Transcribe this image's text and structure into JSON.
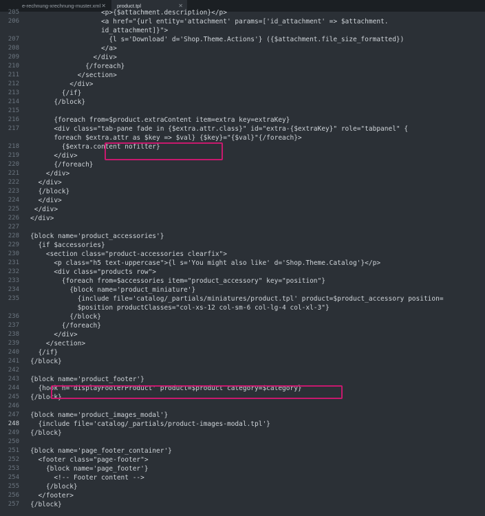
{
  "tabs": [
    {
      "label": "e-rechnung-xrechnung-muster.xml",
      "active": false
    },
    {
      "label": "product.tpl",
      "active": true
    }
  ],
  "lines": [
    {
      "n": "",
      "t": "                  <p>{$attachment.description}</p>"
    },
    {
      "n": "205",
      "t": "                  <p>{$attachment.description}</p>"
    },
    {
      "n": "206",
      "t": "                  <a href=\"{url entity='attachment' params=['id_attachment' => $attachment."
    },
    {
      "n": "",
      "t": "                  id_attachment]}\">"
    },
    {
      "n": "207",
      "t": "                    {l s='Download' d='Shop.Theme.Actions'} ({$attachment.file_size_formatted})"
    },
    {
      "n": "208",
      "t": "                  </a>"
    },
    {
      "n": "209",
      "t": "                </div>"
    },
    {
      "n": "210",
      "t": "              {/foreach}"
    },
    {
      "n": "211",
      "t": "            </section>"
    },
    {
      "n": "212",
      "t": "          </div>"
    },
    {
      "n": "213",
      "t": "        {/if}"
    },
    {
      "n": "214",
      "t": "      {/block}"
    },
    {
      "n": "215",
      "t": ""
    },
    {
      "n": "216",
      "t": "      {foreach from=$product.extraContent item=extra key=extraKey}"
    },
    {
      "n": "217",
      "t": "      <div class=\"tab-pane fade in {$extra.attr.class}\" id=\"extra-{$extraKey}\" role=\"tabpanel\" {"
    },
    {
      "n": "",
      "t": "      foreach $extra.attr as $key => $val} {$key}=\"{$val}\"{/foreach}>"
    },
    {
      "n": "218",
      "t": "        {$extra.content nofilter}"
    },
    {
      "n": "219",
      "t": "      </div>"
    },
    {
      "n": "220",
      "t": "      {/foreach}"
    },
    {
      "n": "221",
      "t": "    </div>"
    },
    {
      "n": "222",
      "t": "  </div>"
    },
    {
      "n": "223",
      "t": "  {/block}"
    },
    {
      "n": "224",
      "t": "  </div>"
    },
    {
      "n": "225",
      "t": " </div>"
    },
    {
      "n": "226",
      "t": "</div>"
    },
    {
      "n": "227",
      "t": ""
    },
    {
      "n": "228",
      "t": "{block name='product_accessories'}"
    },
    {
      "n": "229",
      "t": "  {if $accessories}"
    },
    {
      "n": "230",
      "t": "    <section class=\"product-accessories clearfix\">"
    },
    {
      "n": "231",
      "t": "      <p class=\"h5 text-uppercase\">{l s='You might also like' d='Shop.Theme.Catalog'}</p>"
    },
    {
      "n": "232",
      "t": "      <div class=\"products row\">"
    },
    {
      "n": "233",
      "t": "        {foreach from=$accessories item=\"product_accessory\" key=\"position\"}"
    },
    {
      "n": "234",
      "t": "          {block name='product_miniature'}"
    },
    {
      "n": "235",
      "t": "            {include file='catalog/_partials/miniatures/product.tpl' product=$product_accessory position="
    },
    {
      "n": "",
      "t": "            $position productClasses=\"col-xs-12 col-sm-6 col-lg-4 col-xl-3\"}"
    },
    {
      "n": "236",
      "t": "          {/block}"
    },
    {
      "n": "237",
      "t": "        {/foreach}"
    },
    {
      "n": "238",
      "t": "      </div>"
    },
    {
      "n": "239",
      "t": "    </section>"
    },
    {
      "n": "240",
      "t": "  {/if}"
    },
    {
      "n": "241",
      "t": "{/block}"
    },
    {
      "n": "242",
      "t": ""
    },
    {
      "n": "243",
      "t": "{block name='product_footer'}"
    },
    {
      "n": "244",
      "t": "  {hook h='displayFooterProduct' product=$product category=$category}"
    },
    {
      "n": "245",
      "t": "{/block}"
    },
    {
      "n": "246",
      "t": ""
    },
    {
      "n": "247",
      "t": "{block name='product_images_modal'}"
    },
    {
      "n": "248",
      "t": "  {include file='catalog/_partials/product-images-modal.tpl'}"
    },
    {
      "n": "249",
      "t": "{/block}"
    },
    {
      "n": "250",
      "t": ""
    },
    {
      "n": "251",
      "t": "{block name='page_footer_container'}"
    },
    {
      "n": "252",
      "t": "  <footer class=\"page-footer\">"
    },
    {
      "n": "253",
      "t": "    {block name='page_footer'}"
    },
    {
      "n": "254",
      "t": "      <!-- Footer content -->"
    },
    {
      "n": "255",
      "t": "    {/block}"
    },
    {
      "n": "256",
      "t": "  </footer>"
    },
    {
      "n": "257",
      "t": "{/block}"
    }
  ],
  "current_line": "248",
  "colors": {
    "highlight": "#c8196e",
    "background": "#2b3036"
  }
}
